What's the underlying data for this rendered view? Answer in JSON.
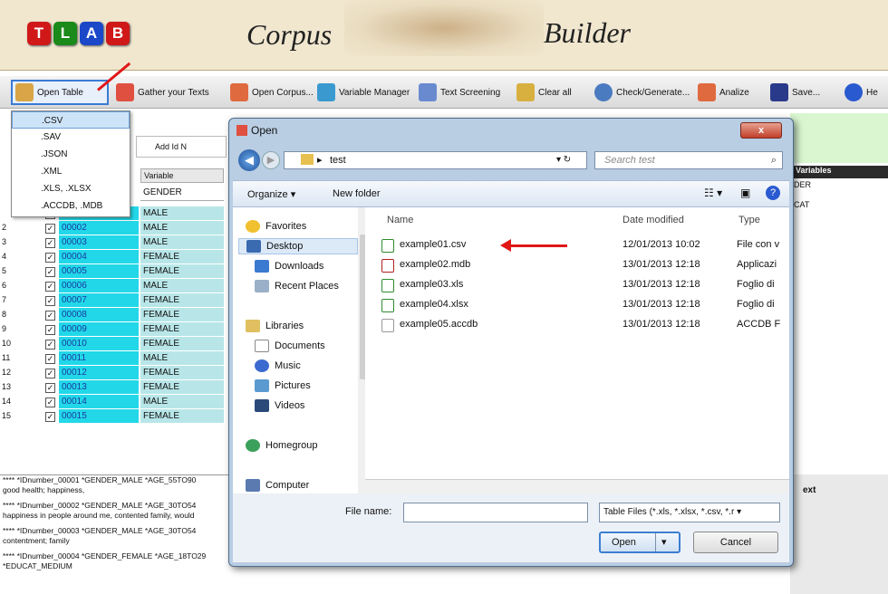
{
  "header": {
    "logo_letters": [
      "T",
      "L",
      "A",
      "B"
    ],
    "logo_colors": [
      "#d01818",
      "#1a8a1a",
      "#1a48c8",
      "#d01818"
    ],
    "title_part1": "Corpus",
    "title_part2": "Builder"
  },
  "toolbar": {
    "items": [
      "Open Table",
      "Gather your Texts",
      "Open Corpus...",
      "Variable Manager",
      "Text Screening",
      "Clear all",
      "Check/Generate...",
      "Analize",
      "Save...",
      "He"
    ]
  },
  "dropdown": {
    "items": [
      ".CSV",
      ".SAV",
      ".JSON",
      ".XML",
      ".XLS, .XLSX",
      ".ACCDB, .MDB"
    ],
    "selected": ".CSV"
  },
  "left_panel": {
    "add_id_label": "Add Id N",
    "col_variable": "Variable",
    "header_value": "GENDER",
    "rows": [
      {
        "n": "",
        "id": "",
        "gender": "MALE"
      },
      {
        "n": "2",
        "id": "00002",
        "gender": "MALE"
      },
      {
        "n": "3",
        "id": "00003",
        "gender": "MALE"
      },
      {
        "n": "4",
        "id": "00004",
        "gender": "FEMALE"
      },
      {
        "n": "5",
        "id": "00005",
        "gender": "FEMALE"
      },
      {
        "n": "6",
        "id": "00006",
        "gender": "MALE"
      },
      {
        "n": "7",
        "id": "00007",
        "gender": "FEMALE"
      },
      {
        "n": "8",
        "id": "00008",
        "gender": "FEMALE"
      },
      {
        "n": "9",
        "id": "00009",
        "gender": "FEMALE"
      },
      {
        "n": "10",
        "id": "00010",
        "gender": "FEMALE"
      },
      {
        "n": "11",
        "id": "00011",
        "gender": "MALE"
      },
      {
        "n": "12",
        "id": "00012",
        "gender": "FEMALE"
      },
      {
        "n": "13",
        "id": "00013",
        "gender": "FEMALE"
      },
      {
        "n": "14",
        "id": "00014",
        "gender": "MALE"
      },
      {
        "n": "15",
        "id": "00015",
        "gender": "FEMALE"
      }
    ],
    "text_lines": [
      "**** *IDnumber_00001 *GENDER_MALE *AGE_55TO90",
      "good health; happiness,",
      "**** *IDnumber_00002 *GENDER_MALE *AGE_30TO54",
      "happiness in people around me, contented family, would",
      "**** *IDnumber_00003 *GENDER_MALE *AGE_30TO54",
      "contentment; family",
      "**** *IDnumber_00004 *GENDER_FEMALE *AGE_18TO29 *EDUCAT_MEDIUM"
    ]
  },
  "right_panel": {
    "variables_header": "Variables",
    "items": [
      "DER",
      "CAT"
    ],
    "ext_label": "ext"
  },
  "dialog": {
    "title": "Open",
    "close": "x",
    "path": "test",
    "search_placeholder": "Search test",
    "organize": "Organize ▾",
    "new_folder": "New folder",
    "nav": {
      "favorites": "Favorites",
      "desktop": "Desktop",
      "downloads": "Downloads",
      "recent": "Recent Places",
      "libraries": "Libraries",
      "documents": "Documents",
      "music": "Music",
      "pictures": "Pictures",
      "videos": "Videos",
      "homegroup": "Homegroup",
      "computer": "Computer"
    },
    "columns": {
      "name": "Name",
      "date": "Date modified",
      "type": "Type"
    },
    "files": [
      {
        "name": "example01.csv",
        "date": "12/01/2013 10:02",
        "type": "File con v",
        "color": "#2f8a2f"
      },
      {
        "name": "example02.mdb",
        "date": "13/01/2013 12:18",
        "type": "Applicazi",
        "color": "#b02020"
      },
      {
        "name": "example03.xls",
        "date": "13/01/2013 12:18",
        "type": "Foglio di",
        "color": "#2f8a2f"
      },
      {
        "name": "example04.xlsx",
        "date": "13/01/2013 12:18",
        "type": "Foglio di",
        "color": "#2f8a2f"
      },
      {
        "name": "example05.accdb",
        "date": "13/01/2013 12:18",
        "type": "ACCDB F",
        "color": "#999999"
      }
    ],
    "file_name_label": "File name:",
    "file_type": "Table Files (*.xls, *.xlsx, *.csv, *.r ▾",
    "open_button": "Open",
    "cancel_button": "Cancel"
  }
}
